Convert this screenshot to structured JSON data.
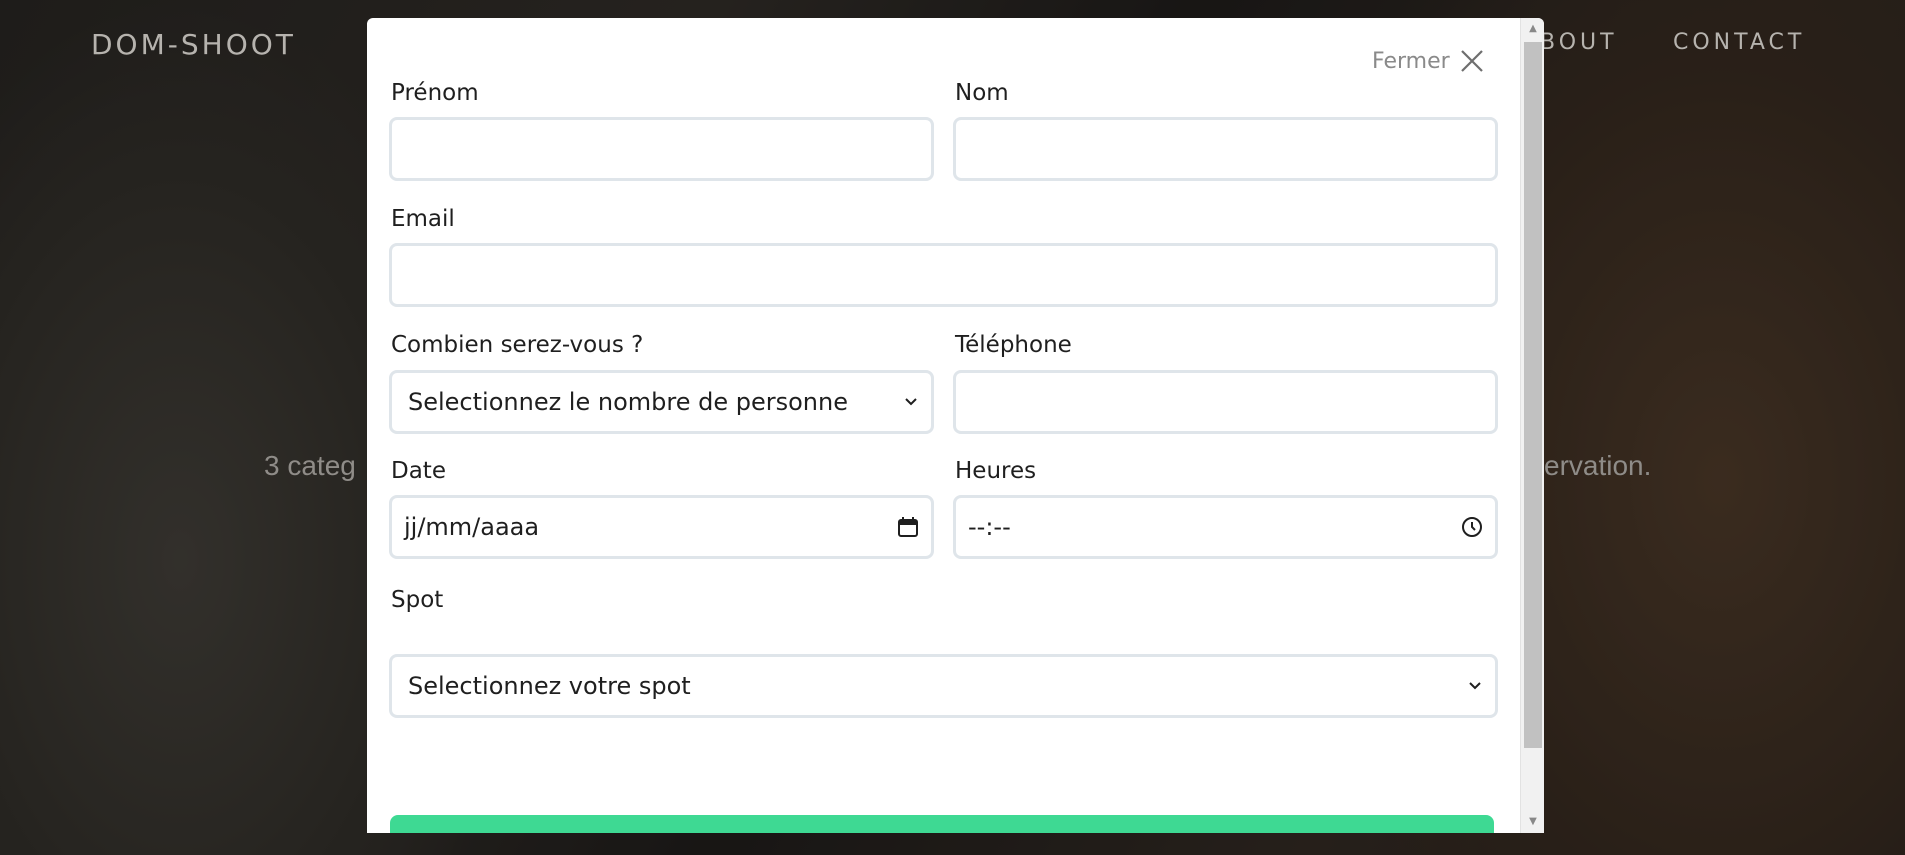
{
  "nav": {
    "brand": "DOM-SHOOT",
    "about": "BOUT",
    "contact": "CONTACT"
  },
  "hero": {
    "text_left": "3 categ",
    "text_right": "ervation."
  },
  "modal": {
    "close_label": "Fermer",
    "fields": {
      "prenom_label": "Prénom",
      "nom_label": "Nom",
      "email_label": "Email",
      "persons_label": "Combien serez-vous ?",
      "persons_selected": "Selectionnez le nombre de personne",
      "telephone_label": "Téléphone",
      "date_label": "Date",
      "date_placeholder": "jj/mm/aaaa",
      "heures_label": "Heures",
      "heures_placeholder": "--:--",
      "spot_label": "Spot",
      "spot_selected": "Selectionnez votre spot"
    },
    "submit_color": "#3ed993"
  }
}
